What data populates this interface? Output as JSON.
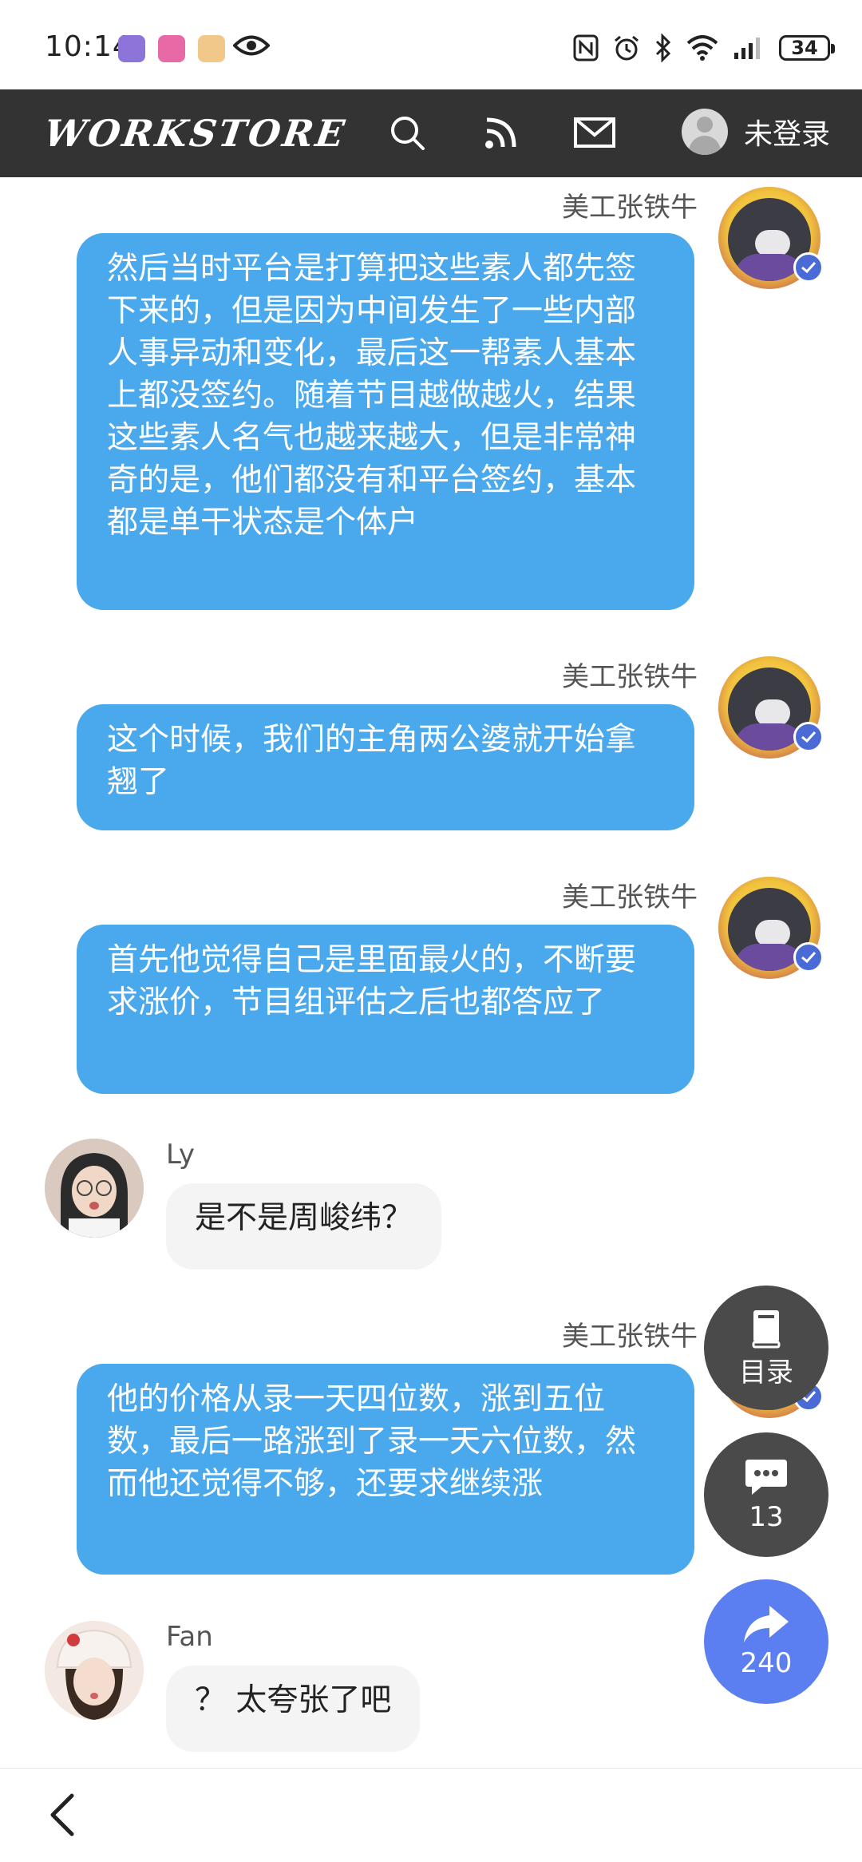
{
  "status_bar": {
    "time": "10:14",
    "battery": "34",
    "colors": {
      "app1": "#8d74d9",
      "app2": "#e76aa6",
      "app3": "#f1c88a"
    }
  },
  "header": {
    "logo": "WORKSTORE",
    "login_label": "未登录",
    "icons": [
      "search-icon",
      "rss-icon",
      "mail-icon",
      "user-avatar"
    ]
  },
  "messages": [
    {
      "sender": "美工张铁牛",
      "side": "right",
      "text": "然后当时平台是打算把这些素人都先签下来的，但是因为中间发生了一些内部人事异动和变化，最后这一帮素人基本上都没签约。随着节目越做越火，结果这些素人名气也越来越大，但是非常神奇的是，他们都没有和平台签约，基本都是单干状态是个体户"
    },
    {
      "sender": "美工张铁牛",
      "side": "right",
      "text": "这个时候，我们的主角两公婆就开始拿翘了"
    },
    {
      "sender": "美工张铁牛",
      "side": "right",
      "text": "首先他觉得自己是里面最火的，不断要求涨价，节目组评估之后也都答应了"
    },
    {
      "sender": "Ly",
      "side": "left",
      "text": "是不是周峻纬？"
    },
    {
      "sender": "美工张铁牛",
      "side": "right",
      "text": "他的价格从录一天四位数，涨到五位数，最后一路涨到了录一天六位数，然而他还觉得不够，还要求继续涨"
    },
    {
      "sender": "Fan",
      "side": "left",
      "text": "？ 太夸张了吧"
    }
  ],
  "floating": {
    "toc_label": "目录",
    "comments_count": "13",
    "share_count": "240"
  },
  "colors": {
    "header_bg": "#333333",
    "bubble_blue": "#4aa8ec",
    "bubble_grey": "#f4f4f4",
    "share_blue": "#5b7ff0"
  }
}
